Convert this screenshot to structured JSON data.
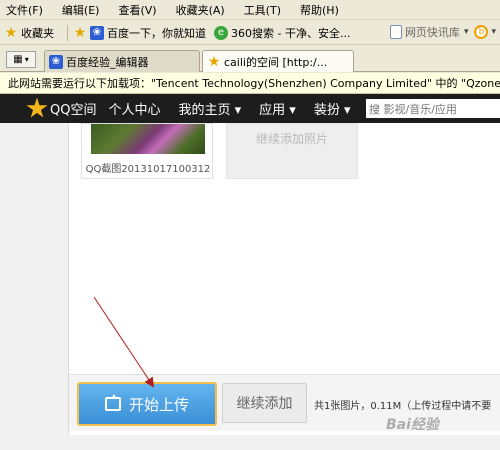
{
  "menu": {
    "items": [
      "文件(F)",
      "编辑(E)",
      "查看(V)",
      "收藏夹(A)",
      "工具(T)",
      "帮助(H)"
    ]
  },
  "favorites": {
    "folder_label": "收藏夹",
    "items": [
      "百度一下，你就知道",
      "360搜索 - 干净、安全..."
    ],
    "right_label": "网页快讯库"
  },
  "tabs": [
    {
      "label": "百度经验_编辑器",
      "active": false
    },
    {
      "label": "caili的空间 [http:/...",
      "active": true
    }
  ],
  "infobar": {
    "text": "此网站需要运行以下加载项：\"Tencent Technology(Shenzhen) Company Limited\" 中的 \"Qzone相册上"
  },
  "qzone": {
    "logo_text": "QQ空间",
    "nav": [
      "个人中心",
      "我的主页 ▾",
      "应用 ▾",
      "装扮 ▾"
    ],
    "search_placeholder": "搜 影视/音乐/应用"
  },
  "upload": {
    "photo_caption": "QQ截图20131017100312",
    "add_more_label": "继续添加照片",
    "start_button": "开始上传",
    "continue_button": "继续添加",
    "status_text": "共1张图片，0.11M（上传过程中请不要"
  },
  "watermark": "Bai经验",
  "colors": {
    "qzone_nav_bg": "#1d1d1d",
    "start_button": "#4a9fe0",
    "start_border": "#f2c04a",
    "arrow": "#b02020"
  }
}
